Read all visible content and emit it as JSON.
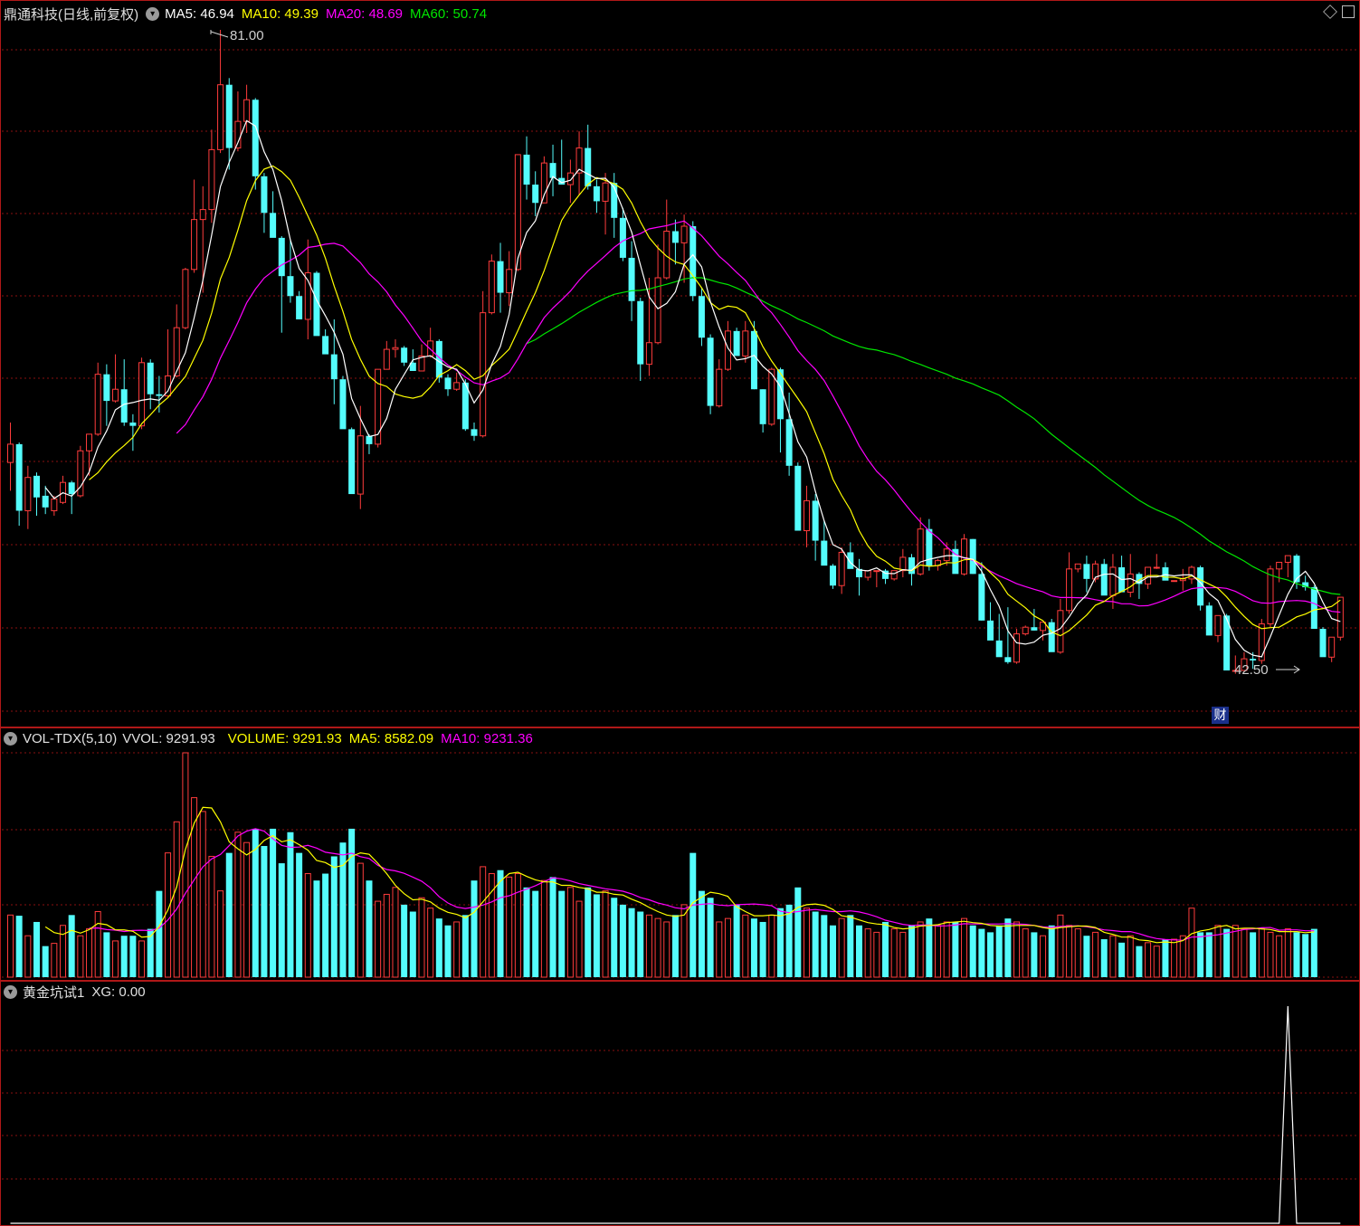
{
  "main": {
    "stock_name": "鼎通科技(日线,前复权)",
    "ma5": "MA5: 46.94",
    "ma10": "MA10: 49.39",
    "ma20": "MA20: 48.69",
    "ma60": "MA60: 50.74",
    "high_label": "81.00",
    "low_label": "42.50",
    "finance_badge": "财"
  },
  "vol": {
    "name": "VOL-TDX(5,10)",
    "vvol": "VVOL: 9291.93",
    "volume": "VOLUME: 9291.93",
    "ma5": "MA5: 8582.09",
    "ma10": "MA10: 9231.36"
  },
  "ind": {
    "name": "黄金坑试1",
    "xg": "XG: 0.00"
  },
  "colors": {
    "up": "#ff3c3c",
    "down": "#54fcfc",
    "ma5": "#ffffff",
    "ma10": "#ffff00",
    "ma20": "#ff00ff",
    "ma60": "#00e600",
    "grid": "#8a1010"
  },
  "chart_data": {
    "type": "candlestick",
    "ohlc": [
      [
        55.0,
        57.4,
        53.3,
        56.1
      ],
      [
        56.1,
        56.2,
        51.2,
        52.1
      ],
      [
        52.1,
        54.8,
        51.0,
        54.1
      ],
      [
        54.2,
        54.4,
        51.8,
        52.9
      ],
      [
        53.0,
        53.6,
        51.9,
        52.3
      ],
      [
        52.1,
        53.0,
        51.8,
        52.8
      ],
      [
        52.6,
        54.2,
        52.5,
        53.8
      ],
      [
        53.8,
        53.9,
        51.9,
        53.1
      ],
      [
        53.0,
        56.0,
        52.9,
        55.7
      ],
      [
        55.7,
        56.1,
        54.2,
        56.7
      ],
      [
        56.7,
        61.0,
        56.6,
        60.3
      ],
      [
        60.3,
        60.9,
        57.2,
        58.7
      ],
      [
        58.7,
        61.5,
        58.6,
        59.4
      ],
      [
        59.4,
        61.2,
        57.2,
        57.4
      ],
      [
        57.4,
        57.9,
        55.7,
        57.2
      ],
      [
        57.2,
        61.3,
        57.0,
        61.0
      ],
      [
        61.0,
        61.2,
        58.2,
        59.1
      ],
      [
        59.1,
        60.2,
        58.0,
        59.0
      ],
      [
        59.0,
        63.0,
        58.9,
        60.2
      ],
      [
        60.2,
        64.5,
        60.1,
        63.1
      ],
      [
        63.1,
        66.7,
        63.0,
        66.6
      ],
      [
        66.6,
        72.0,
        66.4,
        69.6
      ],
      [
        69.6,
        71.6,
        65.2,
        70.2
      ],
      [
        70.2,
        75.0,
        69.4,
        73.8
      ],
      [
        73.8,
        81.0,
        73.6,
        77.7
      ],
      [
        77.7,
        78.1,
        72.6,
        73.9
      ],
      [
        73.9,
        77.3,
        73.7,
        75.5
      ],
      [
        75.5,
        77.7,
        74.8,
        76.8
      ],
      [
        76.8,
        76.9,
        71.4,
        72.2
      ],
      [
        72.2,
        72.4,
        68.8,
        70.0
      ],
      [
        70.0,
        71.3,
        68.6,
        68.5
      ],
      [
        68.5,
        68.6,
        62.8,
        66.2
      ],
      [
        66.2,
        68.4,
        64.6,
        65.0
      ],
      [
        65.0,
        65.3,
        64.2,
        63.6
      ],
      [
        63.6,
        68.4,
        62.4,
        66.4
      ],
      [
        66.4,
        66.5,
        63.2,
        62.6
      ],
      [
        62.6,
        63.0,
        61.6,
        61.5
      ],
      [
        61.5,
        63.6,
        58.5,
        60.0
      ],
      [
        60.0,
        60.2,
        57.5,
        57.0
      ],
      [
        57.0,
        57.1,
        53.3,
        53.1
      ],
      [
        53.1,
        58.4,
        52.2,
        56.6
      ],
      [
        56.6,
        56.7,
        55.5,
        56.1
      ],
      [
        56.1,
        59.7,
        55.9,
        60.6
      ],
      [
        60.6,
        62.3,
        60.6,
        61.8
      ],
      [
        61.8,
        62.4,
        61.3,
        61.9
      ],
      [
        61.9,
        62.0,
        60.8,
        61.0
      ],
      [
        61.0,
        61.8,
        60.5,
        60.5
      ],
      [
        60.5,
        62.1,
        60.6,
        61.4
      ],
      [
        61.4,
        63.1,
        61.3,
        62.3
      ],
      [
        62.3,
        62.4,
        59.8,
        60.1
      ],
      [
        60.1,
        60.3,
        59.0,
        59.4
      ],
      [
        59.4,
        60.4,
        59.3,
        59.8
      ],
      [
        59.8,
        60.0,
        56.9,
        57.0
      ],
      [
        57.0,
        57.4,
        56.3,
        56.6
      ],
      [
        56.6,
        65.3,
        56.5,
        64.0
      ],
      [
        64.0,
        67.5,
        63.9,
        67.1
      ],
      [
        67.1,
        68.2,
        64.0,
        65.2
      ],
      [
        65.2,
        67.7,
        64.4,
        66.6
      ],
      [
        66.6,
        73.5,
        66.5,
        73.5
      ],
      [
        73.5,
        74.6,
        70.8,
        71.7
      ],
      [
        71.7,
        72.5,
        69.8,
        70.6
      ],
      [
        70.6,
        73.4,
        70.6,
        73.0
      ],
      [
        73.0,
        74.1,
        71.0,
        72.1
      ],
      [
        72.1,
        74.4,
        71.8,
        71.7
      ],
      [
        71.7,
        73.2,
        70.6,
        72.4
      ],
      [
        72.4,
        74.9,
        71.1,
        73.9
      ],
      [
        73.9,
        75.3,
        71.4,
        71.6
      ],
      [
        71.6,
        72.0,
        70.0,
        70.7
      ],
      [
        70.7,
        72.4,
        68.7,
        71.8
      ],
      [
        71.8,
        72.4,
        68.5,
        69.7
      ],
      [
        69.7,
        70.3,
        67.1,
        67.3
      ],
      [
        67.3,
        68.3,
        63.5,
        64.7
      ],
      [
        64.7,
        64.9,
        59.9,
        60.9
      ],
      [
        60.9,
        66.1,
        60.2,
        62.2
      ],
      [
        62.2,
        68.1,
        62.1,
        66.1
      ],
      [
        66.1,
        70.8,
        66.0,
        68.9
      ],
      [
        68.9,
        69.6,
        66.9,
        68.2
      ],
      [
        68.2,
        69.9,
        65.8,
        69.2
      ],
      [
        69.2,
        69.5,
        64.7,
        65.0
      ],
      [
        65.0,
        65.5,
        62.0,
        62.5
      ],
      [
        62.5,
        62.7,
        57.9,
        58.4
      ],
      [
        58.4,
        61.2,
        58.3,
        60.6
      ],
      [
        60.6,
        63.5,
        60.5,
        62.9
      ],
      [
        62.9,
        63.1,
        62.2,
        61.4
      ],
      [
        61.4,
        63.5,
        61.0,
        62.9
      ],
      [
        62.9,
        63.5,
        59.4,
        59.4
      ],
      [
        59.4,
        59.4,
        56.8,
        57.3
      ],
      [
        57.3,
        60.7,
        57.2,
        60.6
      ],
      [
        60.6,
        60.7,
        55.6,
        57.6
      ],
      [
        57.6,
        59.2,
        54.2,
        54.8
      ],
      [
        54.8,
        55.0,
        52.7,
        50.9
      ],
      [
        50.9,
        53.6,
        49.9,
        52.7
      ],
      [
        52.7,
        53.1,
        49.1,
        50.3
      ],
      [
        50.3,
        51.5,
        48.9,
        48.8
      ],
      [
        48.8,
        48.9,
        47.4,
        47.6
      ],
      [
        47.6,
        49.9,
        47.1,
        49.6
      ],
      [
        49.6,
        50.2,
        48.8,
        48.6
      ],
      [
        48.6,
        49.2,
        47.0,
        48.1
      ],
      [
        48.1,
        48.5,
        47.9,
        48.5
      ],
      [
        48.5,
        48.5,
        47.5,
        48.5
      ],
      [
        48.5,
        48.6,
        47.7,
        48.0
      ],
      [
        48.0,
        48.4,
        47.9,
        48.5
      ],
      [
        48.5,
        49.8,
        48.1,
        49.3
      ],
      [
        49.3,
        49.5,
        47.6,
        48.3
      ],
      [
        48.3,
        51.7,
        48.2,
        51.0
      ],
      [
        51.0,
        51.6,
        48.5,
        48.8
      ],
      [
        48.8,
        49.2,
        48.5,
        49.1
      ],
      [
        49.1,
        50.2,
        48.8,
        49.8
      ],
      [
        49.8,
        50.3,
        48.5,
        48.3
      ],
      [
        48.3,
        50.7,
        48.2,
        50.4
      ],
      [
        50.4,
        50.4,
        48.3,
        48.3
      ],
      [
        48.3,
        49.0,
        45.5,
        45.5
      ],
      [
        45.5,
        46.6,
        44.5,
        44.3
      ],
      [
        44.3,
        45.9,
        43.6,
        43.3
      ],
      [
        43.3,
        46.3,
        42.9,
        43.0
      ],
      [
        43.0,
        45.0,
        42.9,
        44.7
      ],
      [
        44.7,
        45.2,
        44.6,
        45.1
      ],
      [
        45.1,
        46.2,
        44.9,
        44.9
      ],
      [
        44.9,
        45.3,
        44.3,
        45.4
      ],
      [
        45.4,
        45.6,
        45.0,
        43.6
      ],
      [
        43.6,
        46.8,
        43.5,
        46.1
      ],
      [
        46.1,
        49.6,
        45.9,
        48.6
      ],
      [
        48.6,
        48.9,
        48.4,
        48.9
      ],
      [
        48.9,
        49.4,
        47.2,
        48.0
      ],
      [
        48.0,
        49.1,
        47.8,
        48.9
      ],
      [
        48.9,
        49.2,
        47.5,
        47.0
      ],
      [
        47.0,
        49.5,
        46.2,
        48.7
      ],
      [
        48.7,
        49.4,
        47.6,
        47.2
      ],
      [
        47.2,
        49.5,
        46.9,
        48.3
      ],
      [
        48.3,
        48.4,
        46.8,
        47.7
      ],
      [
        47.7,
        48.7,
        47.4,
        48.7
      ],
      [
        48.7,
        49.5,
        48.6,
        48.7
      ],
      [
        48.7,
        49.0,
        48.3,
        47.9
      ],
      [
        47.9,
        47.4,
        47.4,
        47.9
      ],
      [
        47.9,
        48.6,
        47.3,
        48.0
      ],
      [
        48.0,
        48.8,
        47.7,
        48.7
      ],
      [
        48.7,
        48.8,
        46.1,
        46.4
      ],
      [
        46.4,
        46.6,
        44.9,
        44.6
      ],
      [
        44.6,
        45.8,
        44.2,
        45.8
      ],
      [
        45.8,
        45.9,
        44.4,
        42.5
      ],
      [
        42.5,
        43.4,
        42.3,
        42.5
      ],
      [
        42.5,
        43.6,
        42.5,
        43.2
      ],
      [
        43.2,
        43.6,
        42.6,
        43.1
      ],
      [
        43.1,
        45.6,
        42.9,
        45.3
      ],
      [
        45.3,
        48.8,
        45.1,
        48.6
      ],
      [
        48.6,
        48.8,
        47.8,
        49.0
      ],
      [
        49.0,
        49.1,
        48.1,
        49.4
      ],
      [
        49.4,
        49.5,
        47.4,
        47.8
      ],
      [
        47.8,
        48.2,
        47.3,
        47.5
      ],
      [
        47.5,
        47.6,
        45.1,
        45.0
      ],
      [
        45.0,
        45.1,
        43.6,
        43.3
      ],
      [
        43.3,
        44.3,
        43.0,
        44.5
      ],
      [
        44.5,
        46.0,
        44.3,
        46.9
      ]
    ],
    "volume": [
      1800,
      1780,
      1200,
      1600,
      900,
      980,
      1500,
      1800,
      1200,
      1400,
      1900,
      1300,
      1050,
      1200,
      1200,
      1050,
      1400,
      2500,
      3600,
      4500,
      6500,
      5200,
      4800,
      3500,
      2500,
      3600,
      4200,
      3900,
      4300,
      3800,
      4300,
      3300,
      4200,
      3600,
      3000,
      2800,
      3000,
      3500,
      3900,
      4300,
      3300,
      2800,
      2200,
      2400,
      2600,
      2100,
      1900,
      2300,
      2000,
      1700,
      1500,
      1600,
      1800,
      2800,
      3200,
      3000,
      3100,
      2900,
      3000,
      2600,
      2500,
      2800,
      2900,
      2500,
      2600,
      2200,
      2600,
      2400,
      2500,
      2300,
      2100,
      2000,
      1900,
      1800,
      1700,
      1600,
      1800,
      2100,
      3600,
      2500,
      2300,
      1600,
      1700,
      2100,
      1800,
      1700,
      1600,
      1800,
      2000,
      2100,
      2600,
      2000,
      1900,
      1800,
      1500,
      1700,
      1800,
      1500,
      1400,
      1300,
      1600,
      1400,
      1300,
      1500,
      1600,
      1700,
      1500,
      1600,
      1600,
      1700,
      1500,
      1400,
      1300,
      1500,
      1700,
      1600,
      1400,
      1300,
      1200,
      1500,
      1800,
      1500,
      1400,
      1200,
      1300,
      1100,
      1200,
      1000,
      1200,
      900,
      1000,
      900,
      1100,
      1100,
      1200,
      2000,
      1300,
      1300,
      1500,
      1400,
      1500,
      1400,
      1300,
      1400,
      1300,
      1200,
      1400,
      1300,
      1250,
      1400
    ],
    "xg_signal_index": 146,
    "price_range": [
      42.5,
      81.0
    ],
    "volume_max": 6500,
    "xg_range": [
      0,
      1
    ]
  }
}
